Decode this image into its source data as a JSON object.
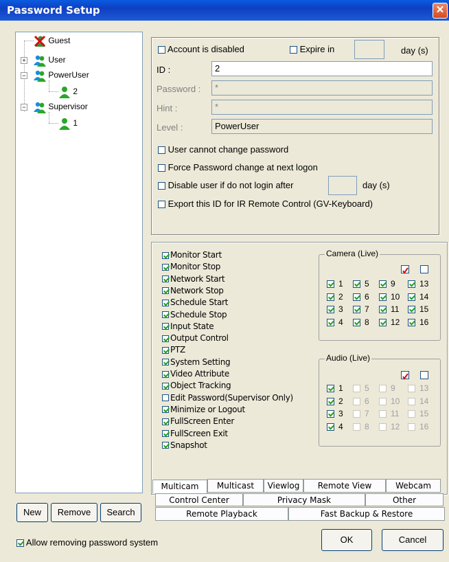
{
  "window": {
    "title": "Password Setup",
    "close_glyph": "✕"
  },
  "tree": {
    "nodes": [
      {
        "label": "Guest",
        "icon": "disabled-user-icon"
      },
      {
        "label": "User",
        "icon": "user-group-icon",
        "expander": "+"
      },
      {
        "label": "PowerUser",
        "icon": "user-group-icon",
        "expander": "−"
      },
      {
        "label": "2",
        "icon": "user-icon"
      },
      {
        "label": "Supervisor",
        "icon": "user-group-icon",
        "expander": "−"
      },
      {
        "label": "1",
        "icon": "user-icon"
      }
    ]
  },
  "buttons": {
    "new": "New",
    "remove": "Remove",
    "search": "Search",
    "ok": "OK",
    "cancel": "Cancel"
  },
  "account": {
    "disabled_label": "Account is disabled",
    "expire_label": "Expire in",
    "expire_value": "",
    "day_unit": "day (s)",
    "id_label": "ID :",
    "id_value": "2",
    "password_label": "Password :",
    "password_value": "*",
    "hint_label": "Hint :",
    "hint_value": "*",
    "level_label": "Level :",
    "level_value": "PowerUser",
    "options": [
      "User cannot change password",
      "Force Password change at next logon",
      "Disable user if do not login after",
      "Export this ID for IR Remote Control (GV-Keyboard)"
    ],
    "disable_days_value": "",
    "disable_days_unit": "day (s)"
  },
  "permissions": [
    {
      "label": "Monitor Start",
      "checked": true
    },
    {
      "label": "Monitor Stop",
      "checked": true
    },
    {
      "label": "Network Start",
      "checked": true
    },
    {
      "label": "Network Stop",
      "checked": true
    },
    {
      "label": "Schedule Start",
      "checked": true
    },
    {
      "label": "Schedule Stop",
      "checked": true
    },
    {
      "label": "Input State",
      "checked": true
    },
    {
      "label": "Output Control",
      "checked": true
    },
    {
      "label": "PTZ",
      "checked": true
    },
    {
      "label": "System Setting",
      "checked": true
    },
    {
      "label": "Video Attribute",
      "checked": true
    },
    {
      "label": "Object Tracking",
      "checked": true
    },
    {
      "label": "Edit Password(Supervisor Only)",
      "checked": false
    },
    {
      "label": "Minimize or Logout",
      "checked": true
    },
    {
      "label": "FullScreen Enter",
      "checked": true
    },
    {
      "label": "FullScreen Exit",
      "checked": true
    },
    {
      "label": "Snapshot",
      "checked": true
    }
  ],
  "camera_live": {
    "title": "Camera (Live)",
    "rows": [
      [
        {
          "n": "1",
          "c": true,
          "e": true
        },
        {
          "n": "5",
          "c": true,
          "e": true
        },
        {
          "n": "9",
          "c": true,
          "e": true
        },
        {
          "n": "13",
          "c": true,
          "e": true
        }
      ],
      [
        {
          "n": "2",
          "c": true,
          "e": true
        },
        {
          "n": "6",
          "c": true,
          "e": true
        },
        {
          "n": "10",
          "c": true,
          "e": true
        },
        {
          "n": "14",
          "c": true,
          "e": true
        }
      ],
      [
        {
          "n": "3",
          "c": true,
          "e": true
        },
        {
          "n": "7",
          "c": true,
          "e": true
        },
        {
          "n": "11",
          "c": true,
          "e": true
        },
        {
          "n": "15",
          "c": true,
          "e": true
        }
      ],
      [
        {
          "n": "4",
          "c": true,
          "e": true
        },
        {
          "n": "8",
          "c": true,
          "e": true
        },
        {
          "n": "12",
          "c": true,
          "e": true
        },
        {
          "n": "16",
          "c": true,
          "e": true
        }
      ]
    ]
  },
  "audio_live": {
    "title": "Audio (Live)",
    "rows": [
      [
        {
          "n": "1",
          "c": true,
          "e": true
        },
        {
          "n": "5",
          "c": false,
          "e": false
        },
        {
          "n": "9",
          "c": false,
          "e": false
        },
        {
          "n": "13",
          "c": false,
          "e": false
        }
      ],
      [
        {
          "n": "2",
          "c": true,
          "e": true
        },
        {
          "n": "6",
          "c": false,
          "e": false
        },
        {
          "n": "10",
          "c": false,
          "e": false
        },
        {
          "n": "14",
          "c": false,
          "e": false
        }
      ],
      [
        {
          "n": "3",
          "c": true,
          "e": true
        },
        {
          "n": "7",
          "c": false,
          "e": false
        },
        {
          "n": "11",
          "c": false,
          "e": false
        },
        {
          "n": "15",
          "c": false,
          "e": false
        }
      ],
      [
        {
          "n": "4",
          "c": true,
          "e": true
        },
        {
          "n": "8",
          "c": false,
          "e": false
        },
        {
          "n": "12",
          "c": false,
          "e": false
        },
        {
          "n": "16",
          "c": false,
          "e": false
        }
      ]
    ]
  },
  "tabs": {
    "row1": [
      "Multicam",
      "Multicast",
      "Viewlog",
      "Remote View",
      "Webcam"
    ],
    "row2": [
      "Control Center",
      "Privacy Mask",
      "Other"
    ],
    "row3": [
      "Remote Playback",
      "Fast Backup & Restore"
    ],
    "active": "Multicam"
  },
  "footer": {
    "allow_removing_label": "Allow removing password system",
    "allow_removing_checked": true
  },
  "colors": {
    "title_bar": "#0f3fc2",
    "check": "#21a121",
    "dialog_bg": "#ece9d8"
  }
}
